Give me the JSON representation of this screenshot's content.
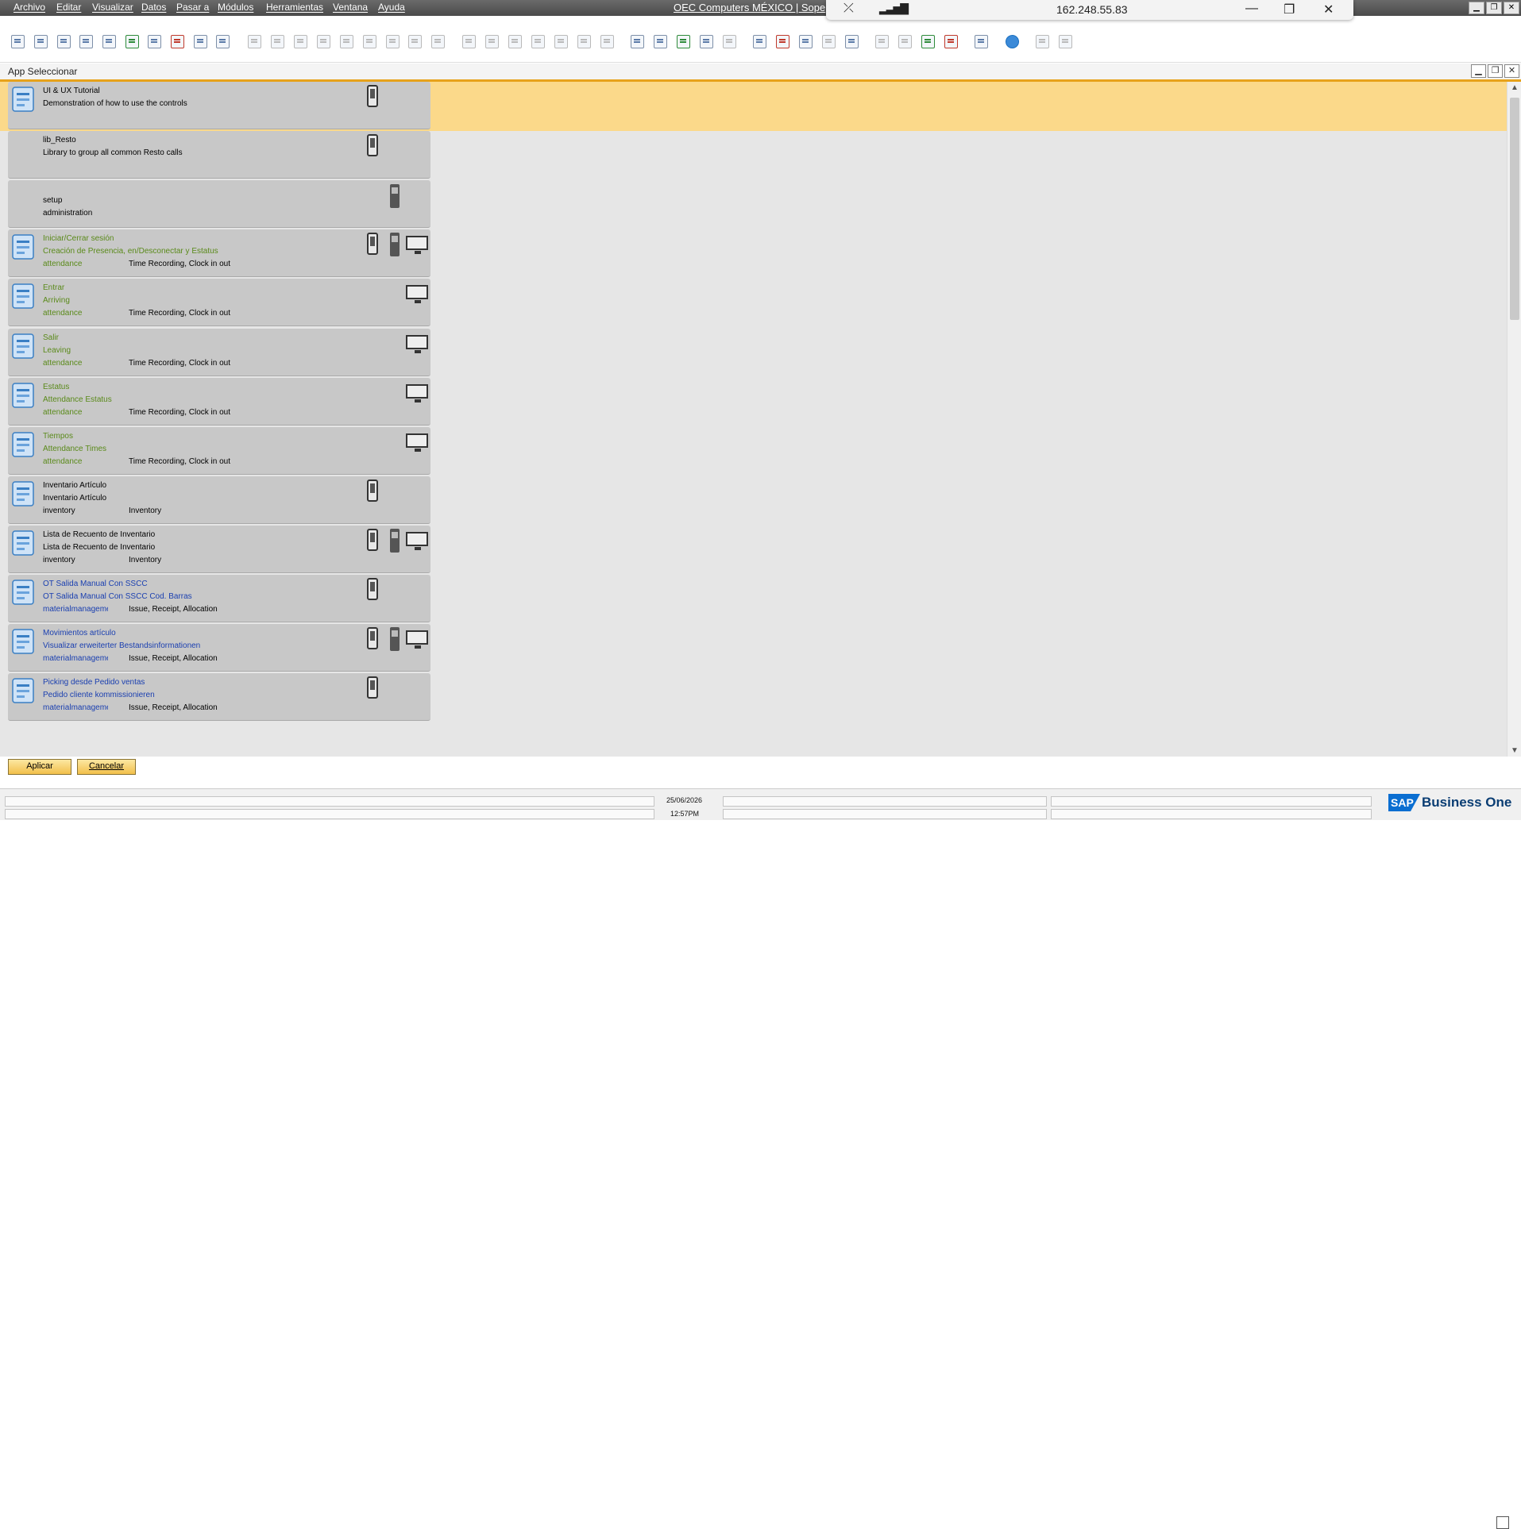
{
  "menu": {
    "items": [
      "Archivo",
      "Editar",
      "Visualizar",
      "Datos",
      "Pasar a",
      "Módulos",
      "Herramientas",
      "Ventana",
      "Ayuda"
    ],
    "company": "OEC Computers MÉXICO | Sope"
  },
  "rdp": {
    "ip": "162.248.55.83"
  },
  "window": {
    "title": "App Seleccionar"
  },
  "apps": [
    {
      "l1": "UI & UX Tutorial",
      "l2": "Demonstration of how to use the controls",
      "cat": "",
      "tag": "",
      "color": "#000000",
      "icon": "presentation-icon",
      "devices": [
        "phone"
      ],
      "selected": true
    },
    {
      "l1": "lib_Resto",
      "l2": "Library to group all common Resto calls",
      "cat": "",
      "tag": "",
      "color": "#000000",
      "icon": "",
      "devices": [
        "phone"
      ]
    },
    {
      "l1": "setup",
      "l2": "administration",
      "cat": "",
      "tag": "",
      "color": "#000000",
      "icon": "",
      "devices": [
        "scanner"
      ],
      "offset": true
    },
    {
      "l1": "Iniciar/Cerrar sesión",
      "l2": "Creación de Presencia, en/Desconectar y Estatus",
      "cat": "attendance",
      "tag": "Time Recording, Clock in out",
      "color": "#5a8a1a",
      "icon": "door-icon",
      "devices": [
        "phone",
        "scanner",
        "monitor"
      ]
    },
    {
      "l1": "Entrar",
      "l2": "Arriving",
      "cat": "attendance",
      "tag": "Time Recording, Clock in out",
      "color": "#5a8a1a",
      "icon": "user-key-icon",
      "devices": [
        "monitor"
      ]
    },
    {
      "l1": "Salir",
      "l2": "Leaving",
      "cat": "attendance",
      "tag": "Time Recording, Clock in out",
      "color": "#5a8a1a",
      "icon": "user-exit-icon",
      "devices": [
        "monitor"
      ]
    },
    {
      "l1": "Estatus",
      "l2": "Attendance Estatus",
      "cat": "attendance",
      "tag": "Time Recording, Clock in out",
      "color": "#5a8a1a",
      "icon": "user-list-icon",
      "devices": [
        "monitor"
      ]
    },
    {
      "l1": "Tiempos",
      "l2": "Attendance Times",
      "cat": "attendance",
      "tag": "Time Recording, Clock in out",
      "color": "#5a8a1a",
      "icon": "timesheet-icon",
      "devices": [
        "monitor"
      ]
    },
    {
      "l1": "Inventario Artículo",
      "l2": "Inventario Artículo",
      "cat": "inventory",
      "tag": "Inventory",
      "color": "#000000",
      "icon": "inventory-icon",
      "devices": [
        "phone"
      ]
    },
    {
      "l1": "Lista de Recuento de Inventario",
      "l2": "Lista de Recuento de Inventario",
      "cat": "inventory",
      "tag": "Inventory",
      "color": "#000000",
      "icon": "counter-icon",
      "devices": [
        "phone",
        "scanner",
        "monitor"
      ]
    },
    {
      "l1": "OT Salida Manual Con SSCC",
      "l2": "OT Salida Manual Con SSCC Cod. Barras",
      "cat": "materialmanagement",
      "tag": "Issue, Receipt, Allocation",
      "color": "#1a3fb0",
      "icon": "hand-box-icon",
      "devices": [
        "phone"
      ]
    },
    {
      "l1": "Movimientos artículo",
      "l2": "Visualizar erweiterter Bestandsinformationen",
      "cat": "materialmanagement",
      "tag": "Issue, Receipt, Allocation",
      "color": "#1a3fb0",
      "icon": "list-icon",
      "devices": [
        "phone",
        "scanner",
        "monitor"
      ]
    },
    {
      "l1": "Picking desde Pedido ventas",
      "l2": "Pedido cliente kommissionieren",
      "cat": "materialmanagement",
      "tag": "Issue, Receipt, Allocation",
      "color": "#1a3fb0",
      "icon": "picking-icon",
      "devices": [
        "phone"
      ]
    }
  ],
  "buttons": {
    "apply": "Aplicar",
    "cancel": "Cancelar"
  },
  "status": {
    "date": "25/06/2026",
    "time": "12:57PM"
  },
  "brand": {
    "sap": "SAP",
    "product": "Business One"
  }
}
